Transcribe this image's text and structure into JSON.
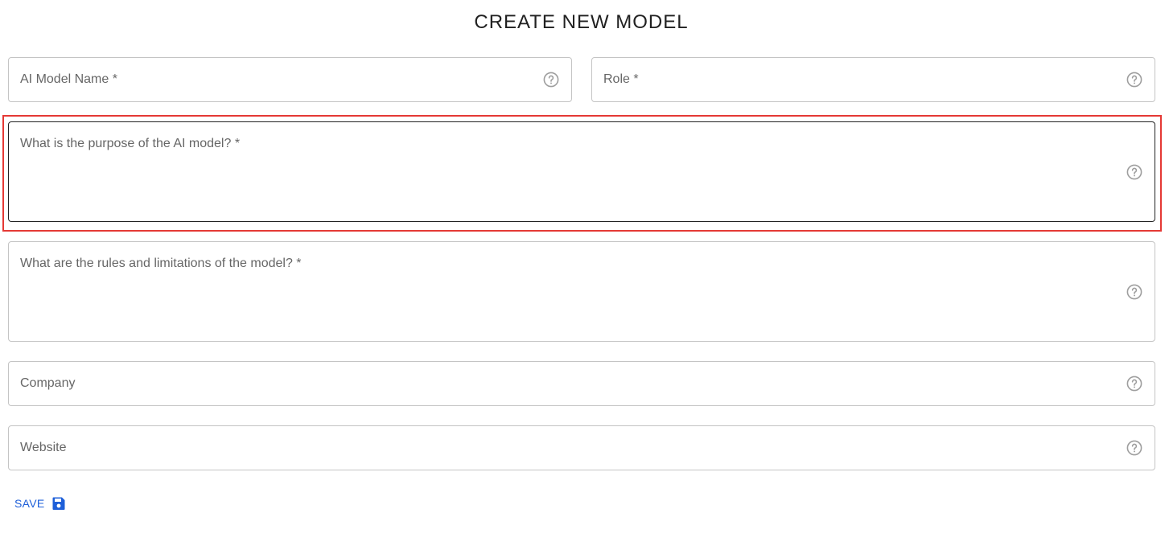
{
  "page": {
    "title": "CREATE NEW MODEL"
  },
  "fields": {
    "model_name": {
      "label": "AI Model Name *"
    },
    "role": {
      "label": "Role *"
    },
    "purpose": {
      "label": "What is the purpose of the AI model? *"
    },
    "rules": {
      "label": "What are the rules and limitations of the model? *"
    },
    "company": {
      "label": "Company"
    },
    "website": {
      "label": "Website"
    }
  },
  "actions": {
    "save_label": "SAVE"
  },
  "icons": {
    "help": "help-circle-icon",
    "save": "floppy-disk-icon"
  },
  "colors": {
    "accent": "#1e5fd9",
    "highlight": "#e53935",
    "border": "#c4c4c4",
    "focused_border": "#222222"
  }
}
